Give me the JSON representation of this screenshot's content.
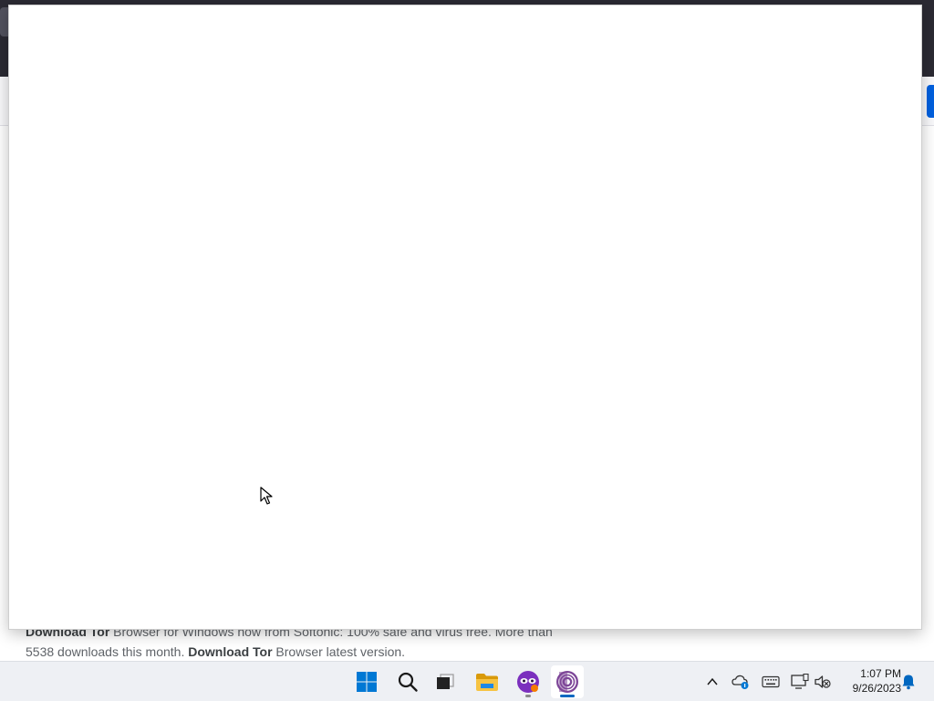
{
  "search_result": {
    "line1_bold": "Download Tor",
    "line1_rest": " Browser for Windows now from Softonic: 100% safe and virus free. More than",
    "line2_start": "5538 downloads this month. ",
    "line2_bold": "Download Tor",
    "line2_rest": " Browser latest version."
  },
  "taskbar": {
    "apps": [
      {
        "name": "start",
        "icon": "windows-logo-icon"
      },
      {
        "name": "search",
        "icon": "search-icon"
      },
      {
        "name": "task-view",
        "icon": "task-view-icon"
      },
      {
        "name": "file-explorer",
        "icon": "folder-icon"
      },
      {
        "name": "mask-app",
        "icon": "mask-app-icon"
      },
      {
        "name": "tor-browser",
        "icon": "tor-browser-icon",
        "active": true
      }
    ],
    "tray": {
      "icons": [
        "chevron-up-icon",
        "onedrive-icon",
        "keyboard-icon",
        "display-icon",
        "speaker-muted-icon",
        "notification-bell-icon"
      ]
    },
    "clock": {
      "time": "1:07 PM",
      "date": "9/26/2023"
    }
  },
  "colors": {
    "accent": "#0067c0",
    "tor_purple": "#7d4698",
    "taskbar_bg": "#eef0f4"
  }
}
